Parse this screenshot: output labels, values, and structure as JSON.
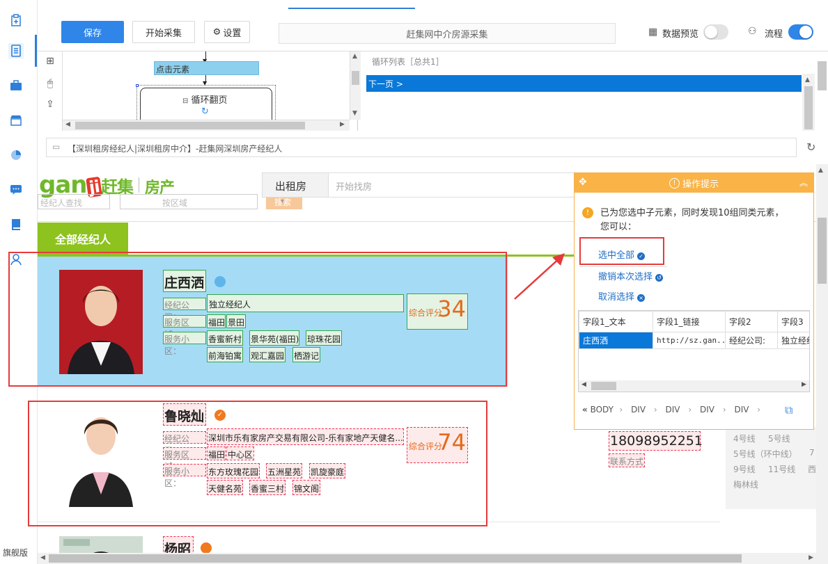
{
  "rail": {
    "edition": "旗舰版"
  },
  "toolbar": {
    "save": "保存",
    "start": "开始采集",
    "settings": "设置",
    "task_name": "赶集网中介房源采集",
    "preview": "数据预览",
    "flow": "流程"
  },
  "workflow": {
    "node_click": "点击元素",
    "node_loop": "循环翻页"
  },
  "loop_list": {
    "title": "循环列表［总共1］",
    "item": "下一页 >"
  },
  "browser": {
    "address": "【深圳租房经纪人|深圳租房中介】-赶集网深圳房产经纪人"
  },
  "site": {
    "logo_main": "gan",
    "logo_ji": "ji",
    "logo_cn": "赶集",
    "logo_sub": "房产",
    "search_select": "出租房",
    "search_placeholder": "开始找房",
    "tab_all": "全部经纪人",
    "ghost_1": "经纪人查找",
    "ghost_2": "按区域",
    "ghost_3": "搜索"
  },
  "agents": [
    {
      "name": "庄西洒",
      "company_label": "经纪公司：",
      "company": "独立经纪人",
      "area_label": "服务区域：",
      "area": [
        "福田",
        "景田"
      ],
      "community_label": "服务小区：",
      "communities": [
        "香蜜新村",
        "景华苑(福田)",
        "琼珠花园",
        "前海铂寓",
        "观汇嘉园",
        "栖游记"
      ],
      "score_label": "综合评分",
      "score": "34"
    },
    {
      "name": "鲁晓灿",
      "company_label": "经纪公司：",
      "company": "深圳市乐有家房产交易有限公司-乐有家地产天健名...",
      "area_label": "服务区域：",
      "area": [
        "福田",
        "中心区"
      ],
      "community_label": "服务小区：",
      "communities": [
        "东方玫瑰花园",
        "五洲星苑",
        "凯旋豪庭",
        "天健名苑",
        "香蜜三村",
        "锦文阁"
      ],
      "score_label": "综合评分",
      "score": "74",
      "phone": "18098952251",
      "contact": "联系方式"
    },
    {
      "name": "杨昭"
    }
  ],
  "metro": {
    "lines": [
      "4号线",
      "5号线",
      "5号线（环中线）",
      "7",
      "9号线",
      "11号线",
      "西",
      "梅林线"
    ]
  },
  "popup": {
    "title": "操作提示",
    "message": "已为您选中子元素，同时发现10组同类元素，您可以：",
    "select_all": "选中全部",
    "undo": "撤销本次选择",
    "cancel": "取消选择",
    "table_headers": [
      "字段1_文本",
      "字段1_链接",
      "字段2",
      "字段3"
    ],
    "table_row": [
      "庄西洒",
      "http://sz.gan...",
      "经纪公司:",
      "独立经纪"
    ],
    "breadcrumb": [
      "BODY",
      "DIV",
      "DIV",
      "DIV",
      "DIV"
    ],
    "breadcrumb_start": "«"
  },
  "colors": {
    "accent": "#2f86e8",
    "green": "#6fb82a",
    "orange": "#f9b347",
    "highlight": "#a6dbf6",
    "red": "#e63a3a"
  }
}
